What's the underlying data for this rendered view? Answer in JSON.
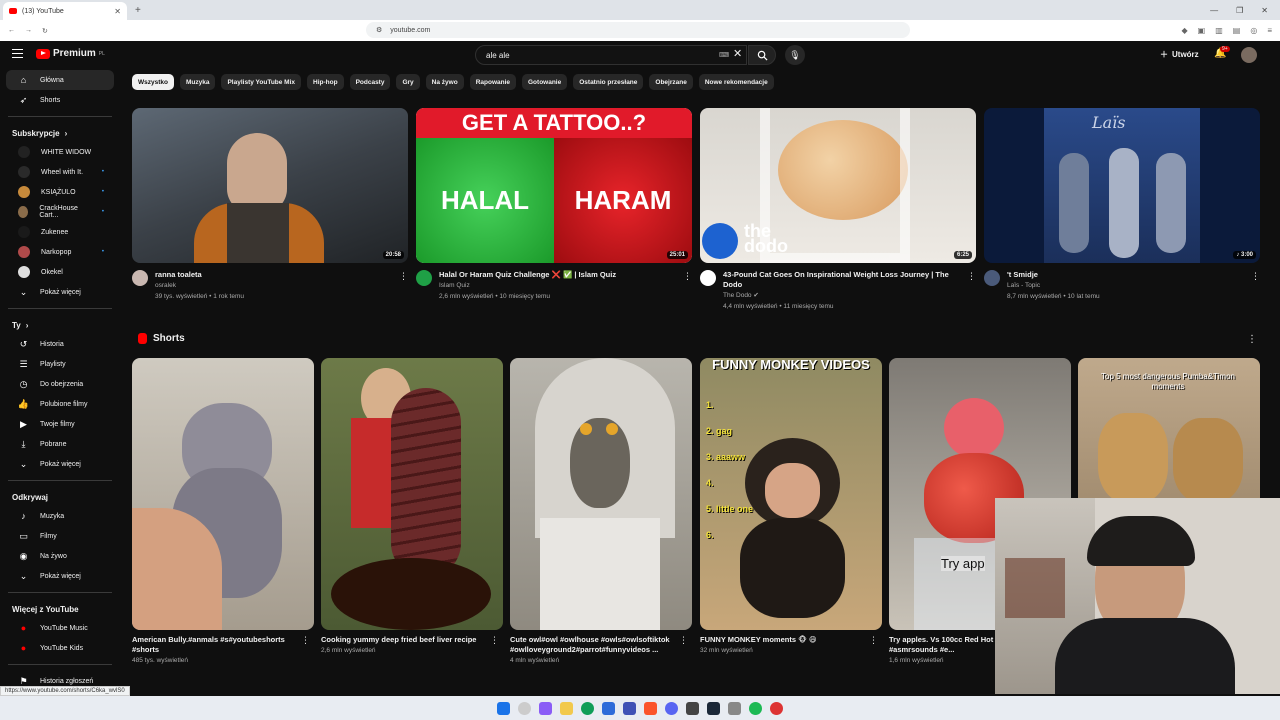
{
  "browser": {
    "tab_title": "(13) YouTube",
    "url": "youtube.com"
  },
  "header": {
    "logo_text": "Premium",
    "logo_sup": "PL",
    "search_value": "ale ale",
    "kbd_label": "⌨",
    "create_label": "Utwórz",
    "notif_count": "9+"
  },
  "sidebar": {
    "main": [
      {
        "label": "Główna",
        "icon": "home-icon"
      },
      {
        "label": "Shorts",
        "icon": "shorts-icon"
      }
    ],
    "subs_header": "Subskrypcje",
    "subs": [
      {
        "label": "WHITE WIDOW",
        "dot": ""
      },
      {
        "label": "Wheel with It.",
        "dot": "•"
      },
      {
        "label": "KSIĄŻULO",
        "dot": "•"
      },
      {
        "label": "CrackHouse Cart...",
        "dot": "•"
      },
      {
        "label": "Zukenee",
        "dot": ""
      },
      {
        "label": "Narkopop",
        "dot": "•"
      },
      {
        "label": "Okekel",
        "dot": ""
      },
      {
        "label": "Pokaż więcej",
        "dot": ""
      }
    ],
    "you_header": "Ty",
    "you": [
      {
        "label": "Historia",
        "icon": "history-icon"
      },
      {
        "label": "Playlisty",
        "icon": "playlist-icon"
      },
      {
        "label": "Do obejrzenia",
        "icon": "clock-icon"
      },
      {
        "label": "Polubione filmy",
        "icon": "thumbs-up-icon"
      },
      {
        "label": "Twoje filmy",
        "icon": "video-icon"
      },
      {
        "label": "Pobrane",
        "icon": "download-icon"
      },
      {
        "label": "Pokaż więcej",
        "icon": "chevron-down-icon"
      }
    ],
    "explore_header": "Odkrywaj",
    "explore": [
      {
        "label": "Muzyka",
        "icon": "music-icon"
      },
      {
        "label": "Filmy",
        "icon": "film-icon"
      },
      {
        "label": "Na żywo",
        "icon": "live-icon"
      },
      {
        "label": "Pokaż więcej",
        "icon": "chevron-down-icon"
      }
    ],
    "more_header": "Więcej z YouTube",
    "more": [
      {
        "label": "YouTube Music"
      },
      {
        "label": "YouTube Kids"
      }
    ],
    "report": "Historia zgłoszeń"
  },
  "chips": [
    "Wszystko",
    "Muzyka",
    "Playlisty YouTube Mix",
    "Hip-hop",
    "Podcasty",
    "Gry",
    "Na żywo",
    "Rapowanie",
    "Gotowanie",
    "Ostatnio przesłane",
    "Obejrzane",
    "Nowe rekomendacje"
  ],
  "videos": [
    {
      "title": "ranna toaleta",
      "channel": "osralek",
      "stats": "39 tys. wyświetleń • 1 rok temu",
      "duration": "20:58"
    },
    {
      "title": "Halal Or Haram Quiz Challenge ❌ ✅ | Islam Quiz",
      "channel": "Islam Quiz",
      "stats": "2,6 mln wyświetleń • 10 miesięcy temu",
      "duration": "25:01",
      "thumb_top": "GET A TATTOO..?",
      "thumb_left": "HALAL",
      "thumb_right": "HARAM"
    },
    {
      "title": "43-Pound Cat Goes On Inspirational Weight Loss Journey | The Dodo",
      "channel": "The Dodo",
      "stats": "4,4 mln wyświetleń • 11 miesięcy temu",
      "duration": "6:25",
      "thumb_logo": "the dodo"
    },
    {
      "title": "'t Smidje",
      "channel": "Laïs - Topic",
      "stats": "8,7 mln wyświetleń • 10 lat temu",
      "duration": "♪ 3:00",
      "thumb_logo": "Laïs"
    }
  ],
  "shorts_header": "Shorts",
  "shorts": [
    {
      "title": "American Bully.#anmals #s#youtubeshorts #shorts",
      "views": "485 tys. wyświetleń"
    },
    {
      "title": "Cooking yummy deep fried beef liver recipe",
      "views": "2,6 mln wyświetleń"
    },
    {
      "title": "Cute owl#owl #owlhouse #owls#owlsoftiktok #owlloveyground2#parrot#funnyvideos ...",
      "views": "4 mln wyświetleń"
    },
    {
      "title": "FUNNY MONKEY moments 🐵 😄",
      "views": "32 mln wyświetleń",
      "overlay_title": "FUNNY MONKEY VIDEOS",
      "overlay_list": [
        "1.",
        "2. gag",
        "3. aaaww",
        "4.",
        "5. little one",
        "6."
      ]
    },
    {
      "title": "Try apples. Vs 100cc Red Hot #redhotball #asmrsounds #e...",
      "views": "1,6 mln wyświetleń",
      "overlay": "Try app"
    },
    {
      "title": "",
      "views": "",
      "overlay": "Top 5 most dangerous Pumba&Timon moments"
    }
  ],
  "status_url": "https://www.youtube.com/shorts/C6ka_wvlS0"
}
